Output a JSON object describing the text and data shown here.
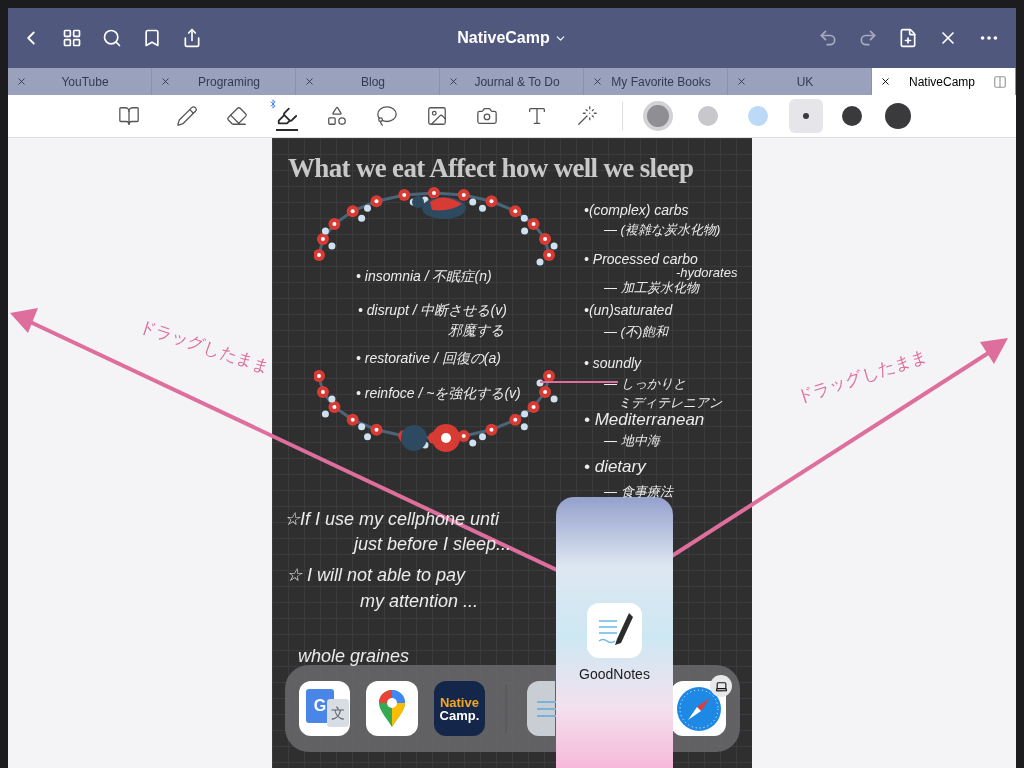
{
  "nav": {
    "title": "NativeCamp"
  },
  "tabs": [
    {
      "label": "YouTube",
      "selected": false
    },
    {
      "label": "Programing",
      "selected": false
    },
    {
      "label": "Blog",
      "selected": false
    },
    {
      "label": "Journal & To Do",
      "selected": false
    },
    {
      "label": "My Favorite Books",
      "selected": false
    },
    {
      "label": "UK",
      "selected": false
    },
    {
      "label": "NativeCamp",
      "selected": true
    }
  ],
  "tools": [
    {
      "kind": "pages",
      "selected": false
    },
    {
      "kind": "pen",
      "selected": false
    },
    {
      "kind": "eraser",
      "selected": false
    },
    {
      "kind": "highlighter",
      "selected": true
    },
    {
      "kind": "shapes",
      "selected": false
    },
    {
      "kind": "lasso",
      "selected": false
    },
    {
      "kind": "image",
      "selected": false
    },
    {
      "kind": "camera",
      "selected": false
    },
    {
      "kind": "text",
      "selected": false
    },
    {
      "kind": "laser",
      "selected": false
    }
  ],
  "colors": [
    {
      "color": "#8e8e93",
      "selected": true
    },
    {
      "color": "#c7c7cc",
      "selected": false
    },
    {
      "color": "#bcd9f7",
      "selected": false
    }
  ],
  "sizes": [
    {
      "selected": true
    },
    {
      "selected": false
    },
    {
      "selected": false
    }
  ],
  "note": {
    "title": "What we eat Affect how well we sleep",
    "items": [
      "• insomnia / 不眠症(n)",
      "• disrupt / 中断させる(v)",
      "邪魔する",
      "• restorative / 回復の(a)",
      "• reinfoce / ~を強化する(v)",
      "•(complex) carbs",
      "— (複雑な炭水化物)",
      "• Processed carbo",
      "-hydorates",
      "— 加工炭水化物",
      "•(un)saturated",
      "— (不)飽和",
      "• soundly",
      "— しっかりと",
      "ミディテレニアン",
      "• Mediterranean",
      "— 地中海",
      "• dietary",
      "— 食事療法",
      "☆If I use my cellphone unti",
      "just before I sleep...",
      "☆ I will not able to pay",
      "my attention ...",
      "whole graines"
    ]
  },
  "annotations": [
    "ドラッグしたまま",
    "ドラッグしたまま"
  ],
  "dock": [
    {
      "kind": "translate",
      "text": "G",
      "text_2": "文"
    },
    {
      "kind": "maps"
    },
    {
      "kind": "nativecamp",
      "text": "Native",
      "text_2": "Camp."
    },
    {
      "kind": "divider"
    },
    {
      "kind": "goodnotes"
    },
    {
      "kind": "safari"
    }
  ],
  "drag_preview": {
    "label": "GoodNotes"
  }
}
